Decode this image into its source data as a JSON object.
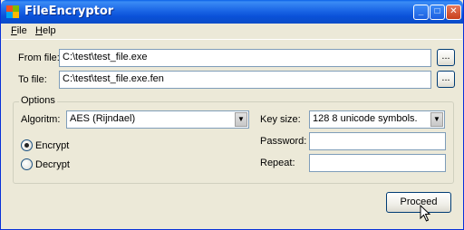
{
  "window": {
    "title": "FileEncryptor",
    "icon": "app-icon",
    "controls": {
      "minimize": "_",
      "maximize": "□",
      "close": "✕"
    }
  },
  "menu": {
    "file": {
      "accel": "F",
      "rest": "ile"
    },
    "help": {
      "accel": "H",
      "rest": "elp"
    }
  },
  "from_file": {
    "label": "From file:",
    "value": "C:\\test\\test_file.exe",
    "browse": "..."
  },
  "to_file": {
    "label": "To file:",
    "value": "C:\\test\\test_file.exe.fen",
    "browse": "..."
  },
  "options": {
    "title": "Options",
    "algorithm_label": "Algoritm:",
    "algorithm_value": "AES (Rijndael)",
    "key_size_label": "Key size:",
    "key_size_value": "128 8 unicode symbols.",
    "password_label": "Password:",
    "password_value": "",
    "repeat_label": "Repeat:",
    "repeat_value": "",
    "encrypt_label": "Encrypt",
    "decrypt_label": "Decrypt",
    "selected_mode": "Encrypt"
  },
  "proceed_label": "Proceed"
}
